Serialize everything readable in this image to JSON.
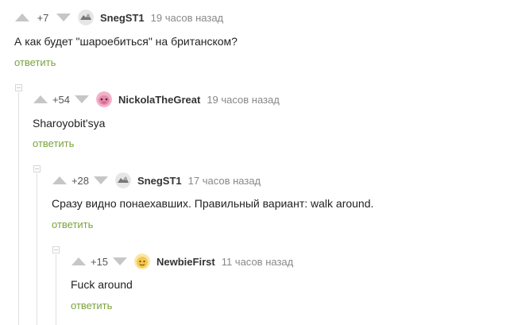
{
  "comments": [
    {
      "rating": "+7",
      "nick": "SnegST1",
      "time": "19 часов назад",
      "text": "А как будет \"шароебиться\" на британском?",
      "reply": "ответить"
    },
    {
      "rating": "+54",
      "nick": "NickolaTheGreat",
      "time": "19 часов назад",
      "text": "Sharoyobit'sya",
      "reply": "ответить"
    },
    {
      "rating": "+28",
      "nick": "SnegST1",
      "time": "17 часов назад",
      "text": "Сразу видно понаехавших. Правильный вариант: walk around.",
      "reply": "ответить"
    },
    {
      "rating": "+15",
      "nick": "NewbieFirst",
      "time": "11 часов назад",
      "text": "Fuck around",
      "reply": "ответить"
    }
  ],
  "colors": {
    "accent": "#7ca23f",
    "muted": "#888888",
    "arrow": "#c6c6c6"
  },
  "icons": {
    "up": "vote-up-icon",
    "down": "vote-down-icon"
  }
}
